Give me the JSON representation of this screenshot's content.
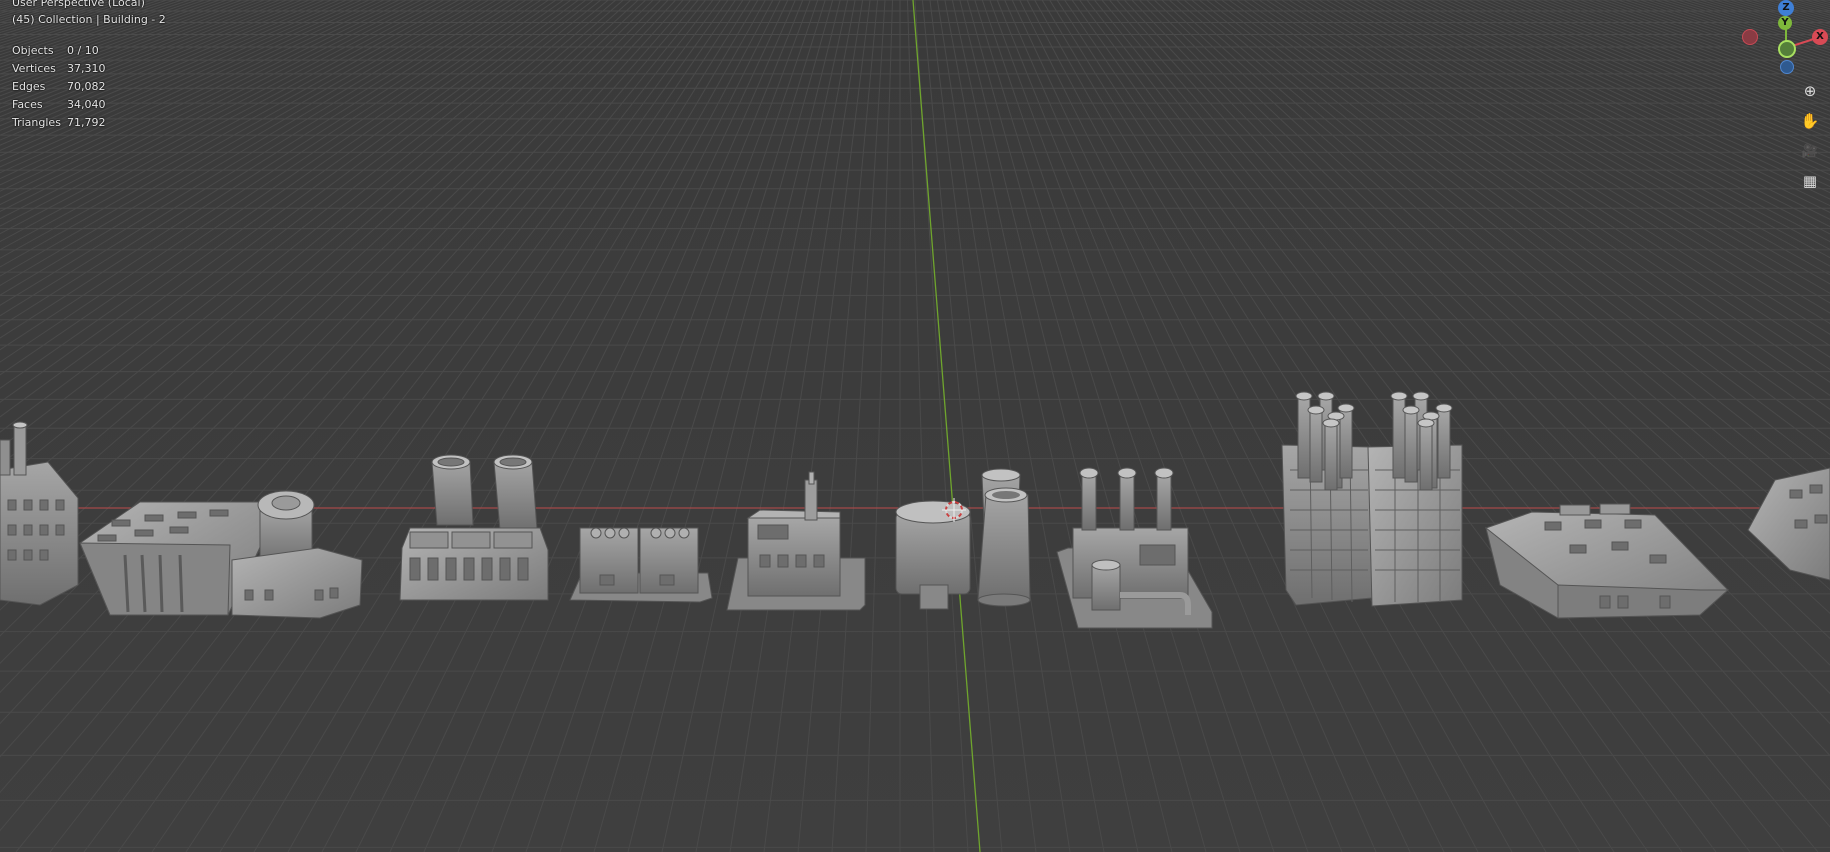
{
  "viewport": {
    "view_name": "User Perspective (Local)",
    "collection_label": "(45) Collection | Building - 2"
  },
  "stats": [
    {
      "label": "Objects",
      "value": "0 / 10"
    },
    {
      "label": "Vertices",
      "value": "37,310"
    },
    {
      "label": "Edges",
      "value": "70,082"
    },
    {
      "label": "Faces",
      "value": "34,040"
    },
    {
      "label": "Triangles",
      "value": "71,792"
    }
  ],
  "gizmo": {
    "z_label": "Z",
    "y_label": "Y",
    "x_label": "X",
    "colors": {
      "x": "#d84a55",
      "y": "#7eb83b",
      "z": "#3f7fd6"
    }
  },
  "nav_tools": [
    {
      "name": "zoom-icon",
      "glyph": "⊕"
    },
    {
      "name": "pan-hand-icon",
      "glyph": "✋"
    },
    {
      "name": "camera-view-icon",
      "glyph": "🎥"
    },
    {
      "name": "ortho-grid-icon",
      "glyph": "▦"
    }
  ],
  "colors": {
    "background": "#3d3d3d",
    "grid": "#4a4a4a",
    "x_axis": "#b84a4a",
    "y_axis": "#6ea82e",
    "model": "#8e8e8e"
  }
}
